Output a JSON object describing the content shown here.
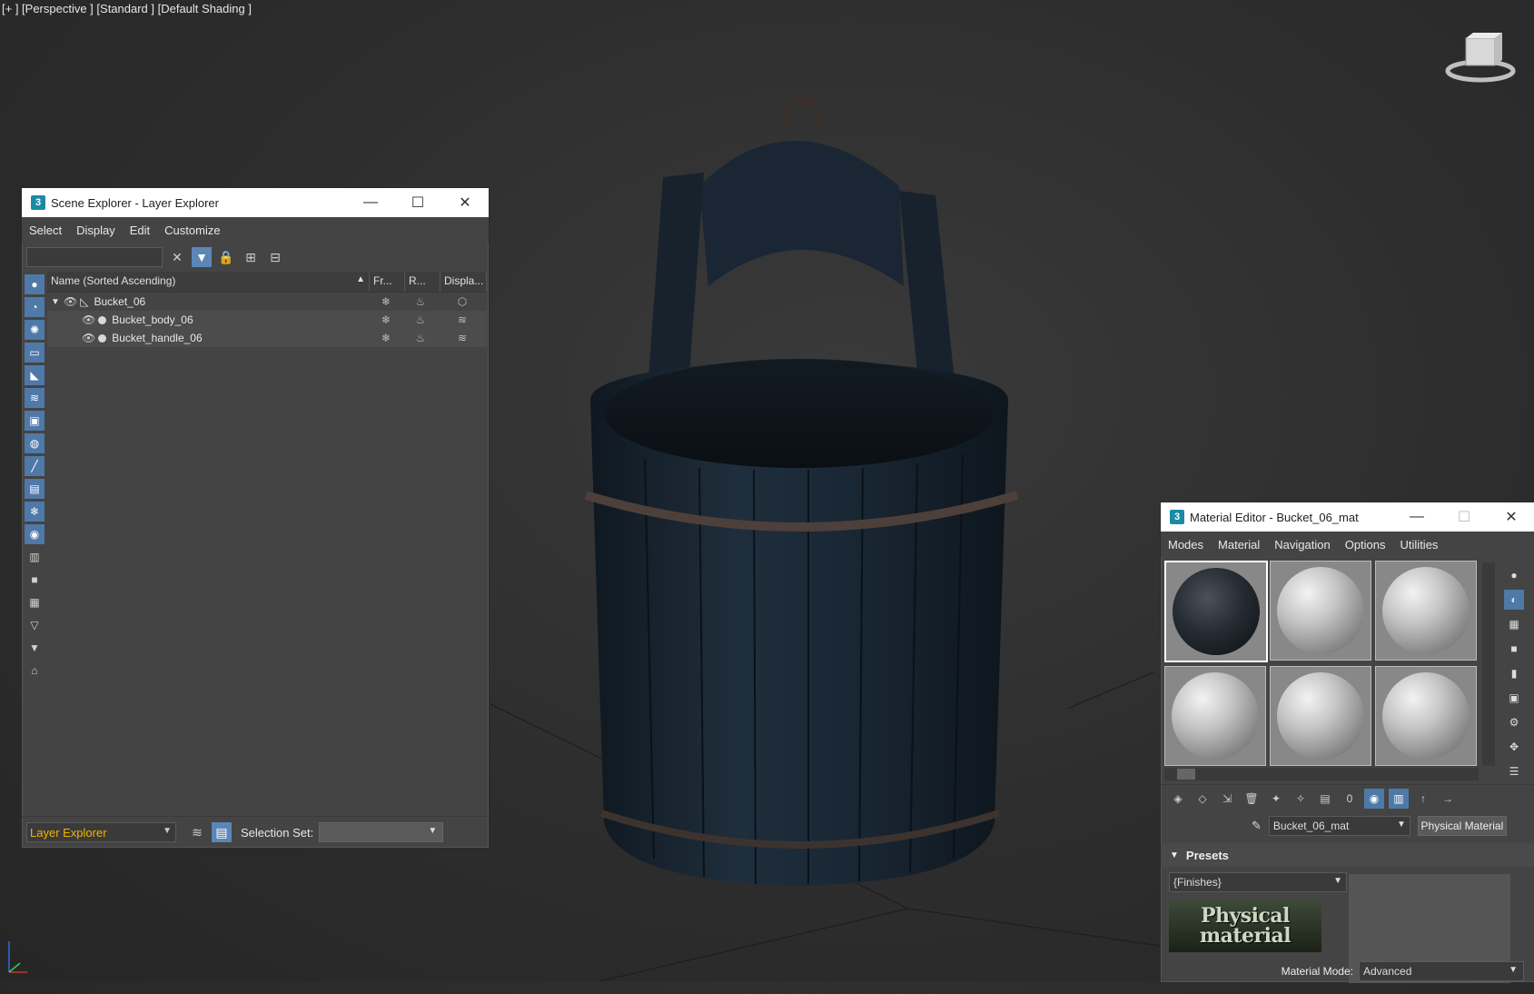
{
  "viewport": {
    "label": "[+ ] [Perspective ] [Standard ] [Default Shading ]"
  },
  "scene_explorer": {
    "title": "Scene Explorer - Layer Explorer",
    "menu": [
      "Select",
      "Display",
      "Edit",
      "Customize"
    ],
    "search_value": "",
    "columns": {
      "name": "Name (Sorted Ascending)",
      "frozen": "Fr...",
      "render": "R...",
      "display": "Displa..."
    },
    "rows": [
      {
        "name": "Bucket_06",
        "level": 0
      },
      {
        "name": "Bucket_body_06",
        "level": 1
      },
      {
        "name": "Bucket_handle_06",
        "level": 1
      }
    ],
    "explorer_mode": "Layer Explorer",
    "selection_set_label": "Selection Set:",
    "selection_set_value": ""
  },
  "material_editor": {
    "title": "Material Editor - Bucket_06_mat",
    "menu": [
      "Modes",
      "Material",
      "Navigation",
      "Options",
      "Utilities"
    ],
    "material_name": "Bucket_06_mat",
    "material_type": "Physical Material",
    "presets_label": "Presets",
    "preset_value": "{Finishes}",
    "logo_line1": "Physical",
    "logo_line2": "material",
    "material_mode_label": "Material Mode:",
    "material_mode_value": "Advanced"
  },
  "colors": {
    "accent": "#4e79a8",
    "explorer_mode_text": "#f0b400",
    "bucket_wood": "#1c2a38",
    "bucket_iron": "#5a4a40"
  }
}
